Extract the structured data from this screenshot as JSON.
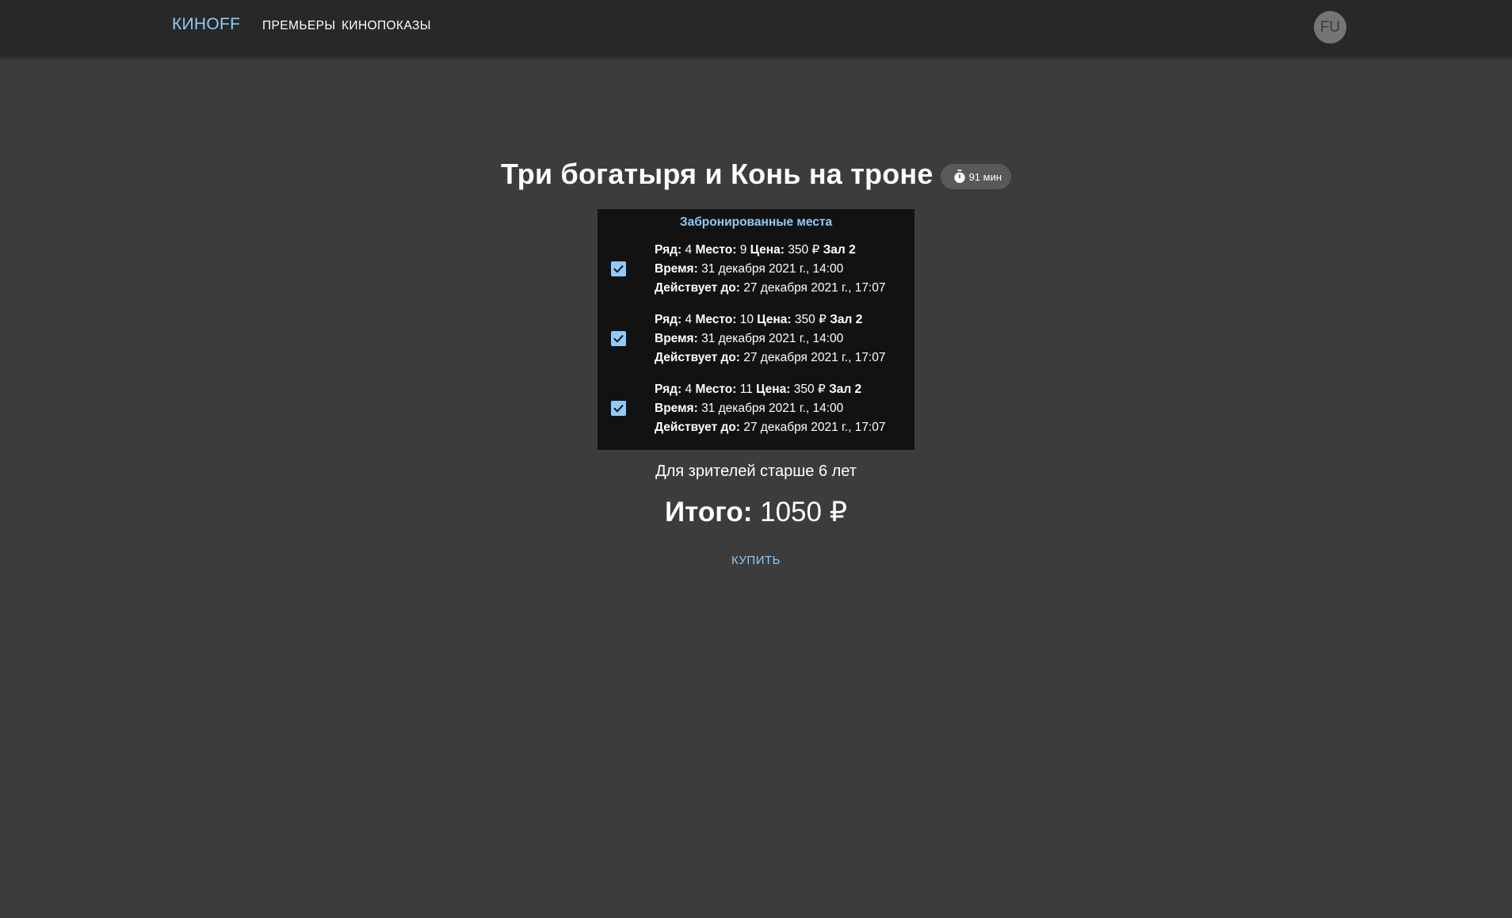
{
  "header": {
    "brand": "КИНOFF",
    "nav": [
      "ПРЕМЬЕРЫ",
      "КИНОПОКАЗЫ"
    ],
    "avatar_initials": "FU"
  },
  "movie": {
    "title": "Три богатыря и Конь на троне",
    "duration": "91 мин",
    "age_note": "Для зрителей старше 6 лет"
  },
  "booked": {
    "title": "Забронированные места",
    "labels": {
      "row": "Ряд:",
      "seat": "Место:",
      "price": "Цена:",
      "time": "Время:",
      "valid_until": "Действует до:"
    },
    "items": [
      {
        "checked": true,
        "row": "4",
        "seat": "9",
        "price": "350 ₽",
        "hall": "Зал 2",
        "time": "31 декабря 2021 г., 14:00",
        "valid_until": "27 декабря 2021 г., 17:07"
      },
      {
        "checked": true,
        "row": "4",
        "seat": "10",
        "price": "350 ₽",
        "hall": "Зал 2",
        "time": "31 декабря 2021 г., 14:00",
        "valid_until": "27 декабря 2021 г., 17:07"
      },
      {
        "checked": true,
        "row": "4",
        "seat": "11",
        "price": "350 ₽",
        "hall": "Зал 2",
        "time": "31 декабря 2021 г., 14:00",
        "valid_until": "27 декабря 2021 г., 17:07"
      }
    ]
  },
  "total": {
    "label": "Итого:",
    "value": "1050 ₽"
  },
  "buy_label": "КУПИТЬ",
  "colors": {
    "background": "#3c3c3c",
    "appbar": "#282828",
    "accent": "#90caf9",
    "panel": "#121212"
  }
}
